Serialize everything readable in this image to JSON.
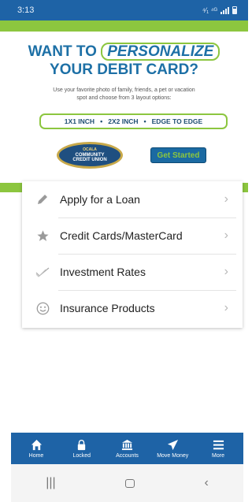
{
  "status_bar": {
    "time": "3:13",
    "indicators": "⁴⁄₁ ⁴ᴳ"
  },
  "banner": {
    "headline_prefix": "WANT TO",
    "headline_emphasis": "PERSONALIZE",
    "headline_line2": "YOUR DEBIT CARD?",
    "subtext": "Use your favorite photo of family, friends, a pet or vacation spot and choose from 3 layout options:",
    "option_1": "1X1 INCH",
    "option_2": "2X2 INCH",
    "option_3": "EDGE TO EDGE",
    "separator": "•",
    "logo_line1": "OCALA",
    "logo_line2": "COMMUNITY",
    "logo_line3": "CREDIT UNION",
    "cta_label": "Get Started"
  },
  "menu": {
    "items": [
      {
        "label": "Apply for a Loan",
        "icon": "pencil-icon"
      },
      {
        "label": "Credit Cards/MasterCard",
        "icon": "star-icon"
      },
      {
        "label": "Investment Rates",
        "icon": "checkmark-icon"
      },
      {
        "label": "Insurance Products",
        "icon": "smiley-icon"
      }
    ],
    "chevron": "›"
  },
  "bottom_nav": {
    "items": [
      {
        "label": "Home",
        "icon": "home-icon"
      },
      {
        "label": "Locked",
        "icon": "lock-icon"
      },
      {
        "label": "Accounts",
        "icon": "bank-icon"
      },
      {
        "label": "Move Money",
        "icon": "send-icon"
      },
      {
        "label": "More",
        "icon": "menu-icon"
      }
    ]
  },
  "system_nav": {
    "recents": "|||",
    "back": "‹"
  },
  "colors": {
    "primary": "#1e63a6",
    "accent_green": "#8cc63f",
    "headline_blue": "#1d70a6"
  }
}
